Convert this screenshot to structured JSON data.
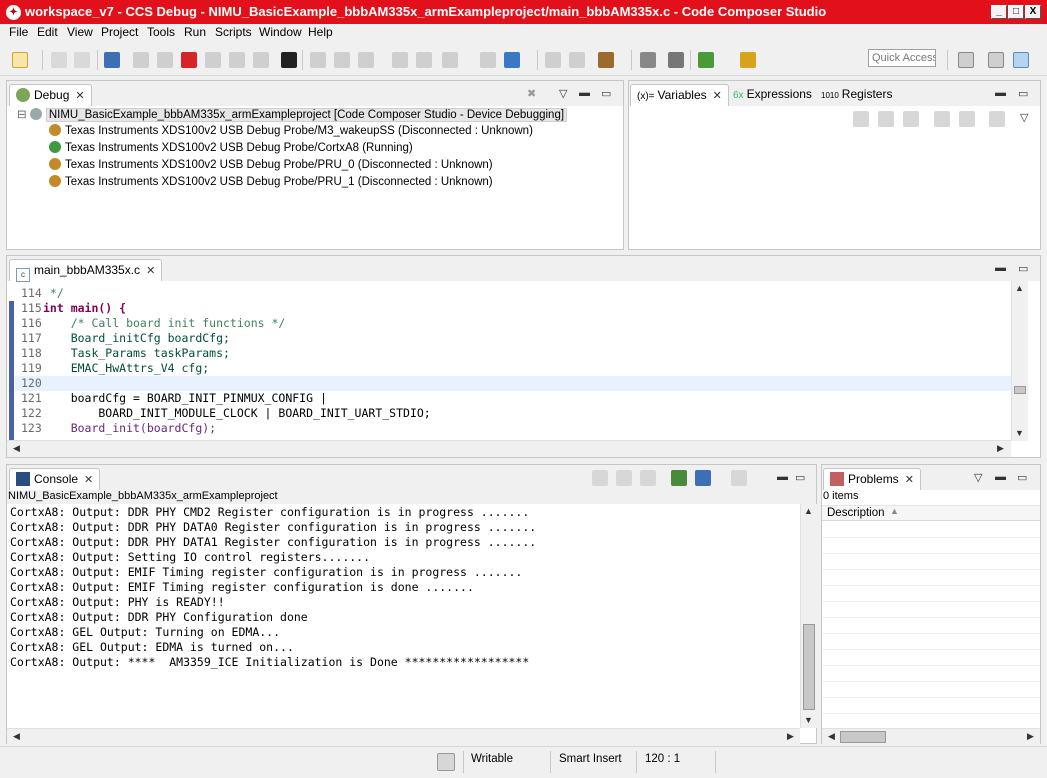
{
  "window": {
    "title": "workspace_v7 - CCS Debug - NIMU_BasicExample_bbbAM335x_armExampleproject/main_bbbAM335x.c - Code Composer Studio",
    "minimize": "_",
    "maximize": "□",
    "close": "X"
  },
  "menu": [
    "File",
    "Edit",
    "View",
    "Project",
    "Tools",
    "Run",
    "Scripts",
    "Window",
    "Help"
  ],
  "toolbar": {
    "quick_access_placeholder": "Quick Access"
  },
  "debug_view": {
    "tab_label": "Debug",
    "root": "NIMU_BasicExample_bbbAM335x_armExampleproject [Code Composer Studio - Device Debugging]",
    "items": [
      "Texas Instruments XDS100v2 USB Debug Probe/M3_wakeupSS (Disconnected : Unknown)",
      "Texas Instruments XDS100v2 USB Debug Probe/CortxA8 (Running)",
      "Texas Instruments XDS100v2 USB Debug Probe/PRU_0 (Disconnected : Unknown)",
      "Texas Instruments XDS100v2 USB Debug Probe/PRU_1 (Disconnected : Unknown)"
    ]
  },
  "variables_view": {
    "tabs": [
      "Variables",
      "Expressions",
      "Registers"
    ],
    "icons": [
      "(x)=",
      "6x",
      "1010"
    ]
  },
  "editor": {
    "tab_label": "main_bbbAM335x.c",
    "lines": [
      {
        "n": "114",
        "text": " */"
      },
      {
        "n": "115",
        "text": "int main() {"
      },
      {
        "n": "116",
        "text": "    /* Call board init functions */"
      },
      {
        "n": "117",
        "text": "    Board_initCfg boardCfg;"
      },
      {
        "n": "118",
        "text": "    Task_Params taskParams;"
      },
      {
        "n": "119",
        "text": "    EMAC_HwAttrs_V4 cfg;"
      },
      {
        "n": "120",
        "text": ""
      },
      {
        "n": "121",
        "text": "    boardCfg = BOARD_INIT_PINMUX_CONFIG |"
      },
      {
        "n": "122",
        "text": "        BOARD_INIT_MODULE_CLOCK | BOARD_INIT_UART_STDIO;"
      },
      {
        "n": "123",
        "text": "    Board_init(boardCfg);"
      }
    ]
  },
  "console": {
    "tab_label": "Console",
    "project": "NIMU_BasicExample_bbbAM335x_armExampleproject",
    "lines": [
      "CortxA8: Output: DDR PHY CMD2 Register configuration is in progress .......",
      "CortxA8: Output: DDR PHY DATA0 Register configuration is in progress .......",
      "CortxA8: Output: DDR PHY DATA1 Register configuration is in progress .......",
      "CortxA8: Output: Setting IO control registers.......",
      "CortxA8: Output: EMIF Timing register configuration is in progress .......",
      "CortxA8: Output: EMIF Timing register configuration is done .......",
      "CortxA8: Output: PHY is READY!!",
      "CortxA8: Output: DDR PHY Configuration done",
      "CortxA8: GEL Output: Turning on EDMA...",
      "CortxA8: GEL Output: EDMA is turned on...",
      "CortxA8: Output: ****  AM3359_ICE Initialization is Done ******************"
    ]
  },
  "problems": {
    "tab_label": "Problems",
    "count": "0 items",
    "column": "Description"
  },
  "status": {
    "writable": "Writable",
    "insert_mode": "Smart Insert",
    "position": "120 : 1"
  }
}
